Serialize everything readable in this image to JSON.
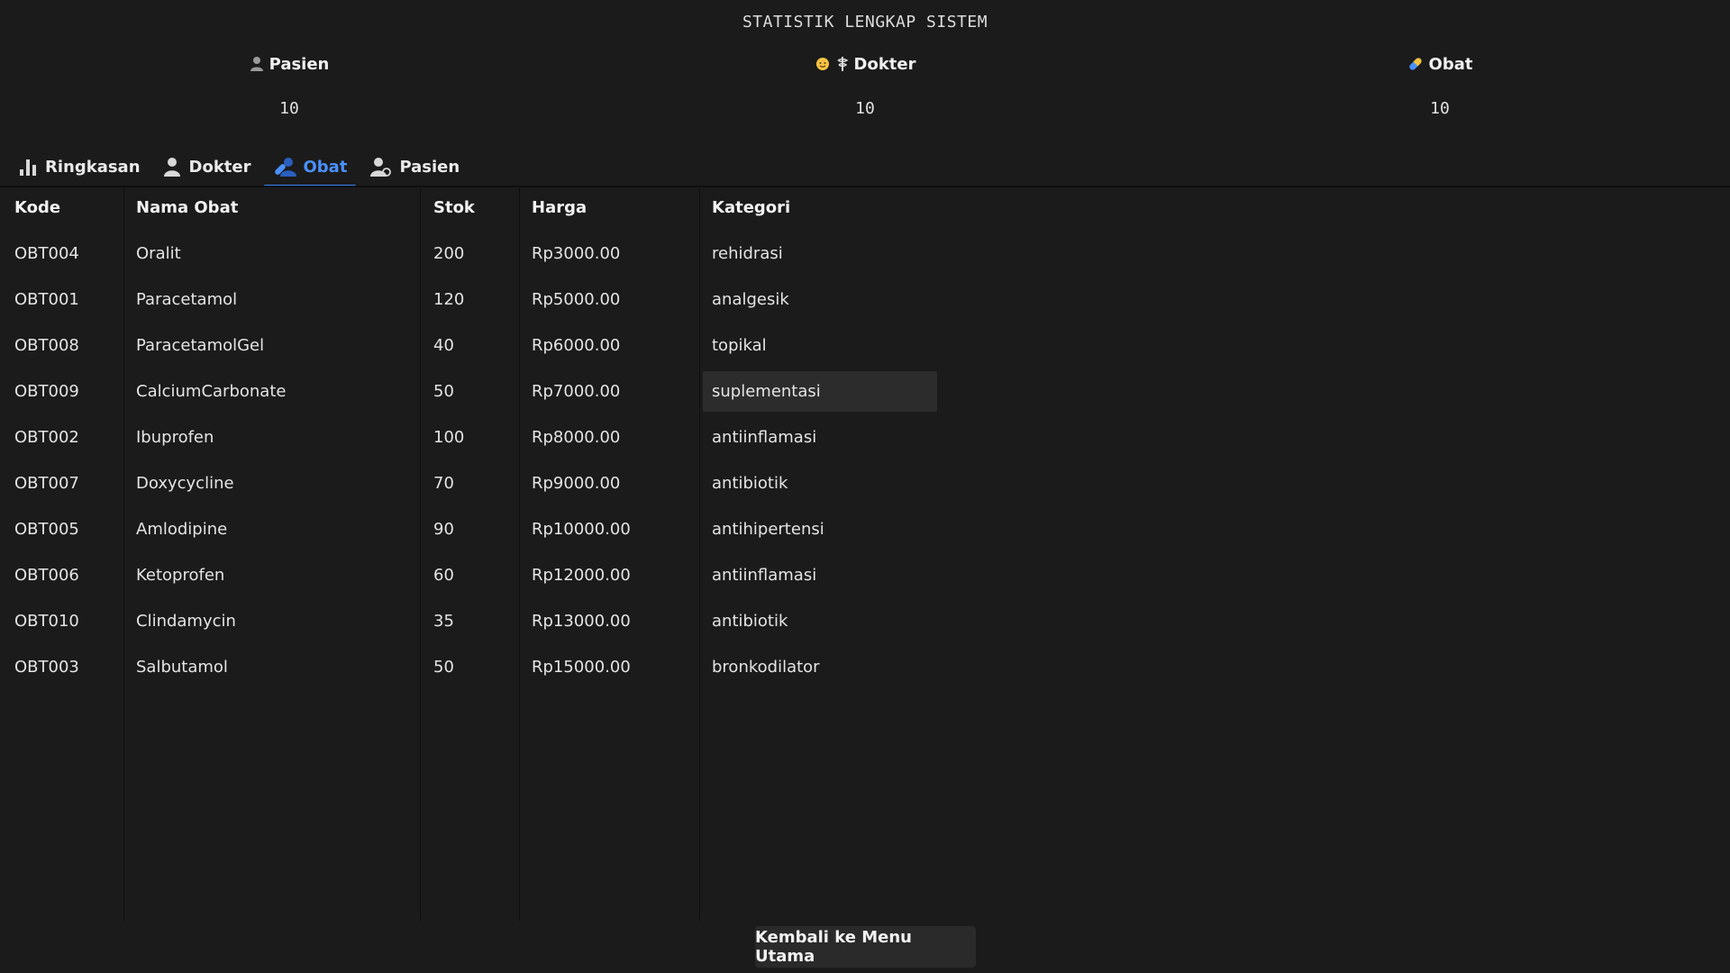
{
  "title": "STATISTIK LENGKAP SISTEM",
  "stats": {
    "pasien": {
      "label": "Pasien",
      "value": "10"
    },
    "dokter": {
      "label": "Dokter",
      "value": "10"
    },
    "obat": {
      "label": "Obat",
      "value": "10"
    }
  },
  "tabs": [
    {
      "label": "Ringkasan",
      "icon": "bar-chart-icon"
    },
    {
      "label": "Dokter",
      "icon": "doctor-icon"
    },
    {
      "label": "Obat",
      "icon": "medicine-icon",
      "active": true
    },
    {
      "label": "Pasien",
      "icon": "patient-icon"
    }
  ],
  "table": {
    "headers": [
      "Kode",
      "Nama Obat",
      "Stok",
      "Harga",
      "Kategori"
    ],
    "rows": [
      [
        "OBT004",
        "Oralit",
        "200",
        "Rp3000.00",
        "rehidrasi"
      ],
      [
        "OBT001",
        "Paracetamol",
        "120",
        "Rp5000.00",
        "analgesik"
      ],
      [
        "OBT008",
        "ParacetamolGel",
        "40",
        "Rp6000.00",
        "topikal"
      ],
      [
        "OBT009",
        "CalciumCarbonate",
        "50",
        "Rp7000.00",
        "suplementasi"
      ],
      [
        "OBT002",
        "Ibuprofen",
        "100",
        "Rp8000.00",
        "antiinflamasi"
      ],
      [
        "OBT007",
        "Doxycycline",
        "70",
        "Rp9000.00",
        "antibiotik"
      ],
      [
        "OBT005",
        "Amlodipine",
        "90",
        "Rp10000.00",
        "antihipertensi"
      ],
      [
        "OBT006",
        "Ketoprofen",
        "60",
        "Rp12000.00",
        "antiinflamasi"
      ],
      [
        "OBT010",
        "Clindamycin",
        "35",
        "Rp13000.00",
        "antibiotik"
      ],
      [
        "OBT003",
        "Salbutamol",
        "50",
        "Rp15000.00",
        "bronkodilator"
      ]
    ]
  },
  "back_button": "Kembali ke Menu Utama",
  "colors": {
    "accent": "#3b82f6",
    "background": "#1b1b1b"
  }
}
